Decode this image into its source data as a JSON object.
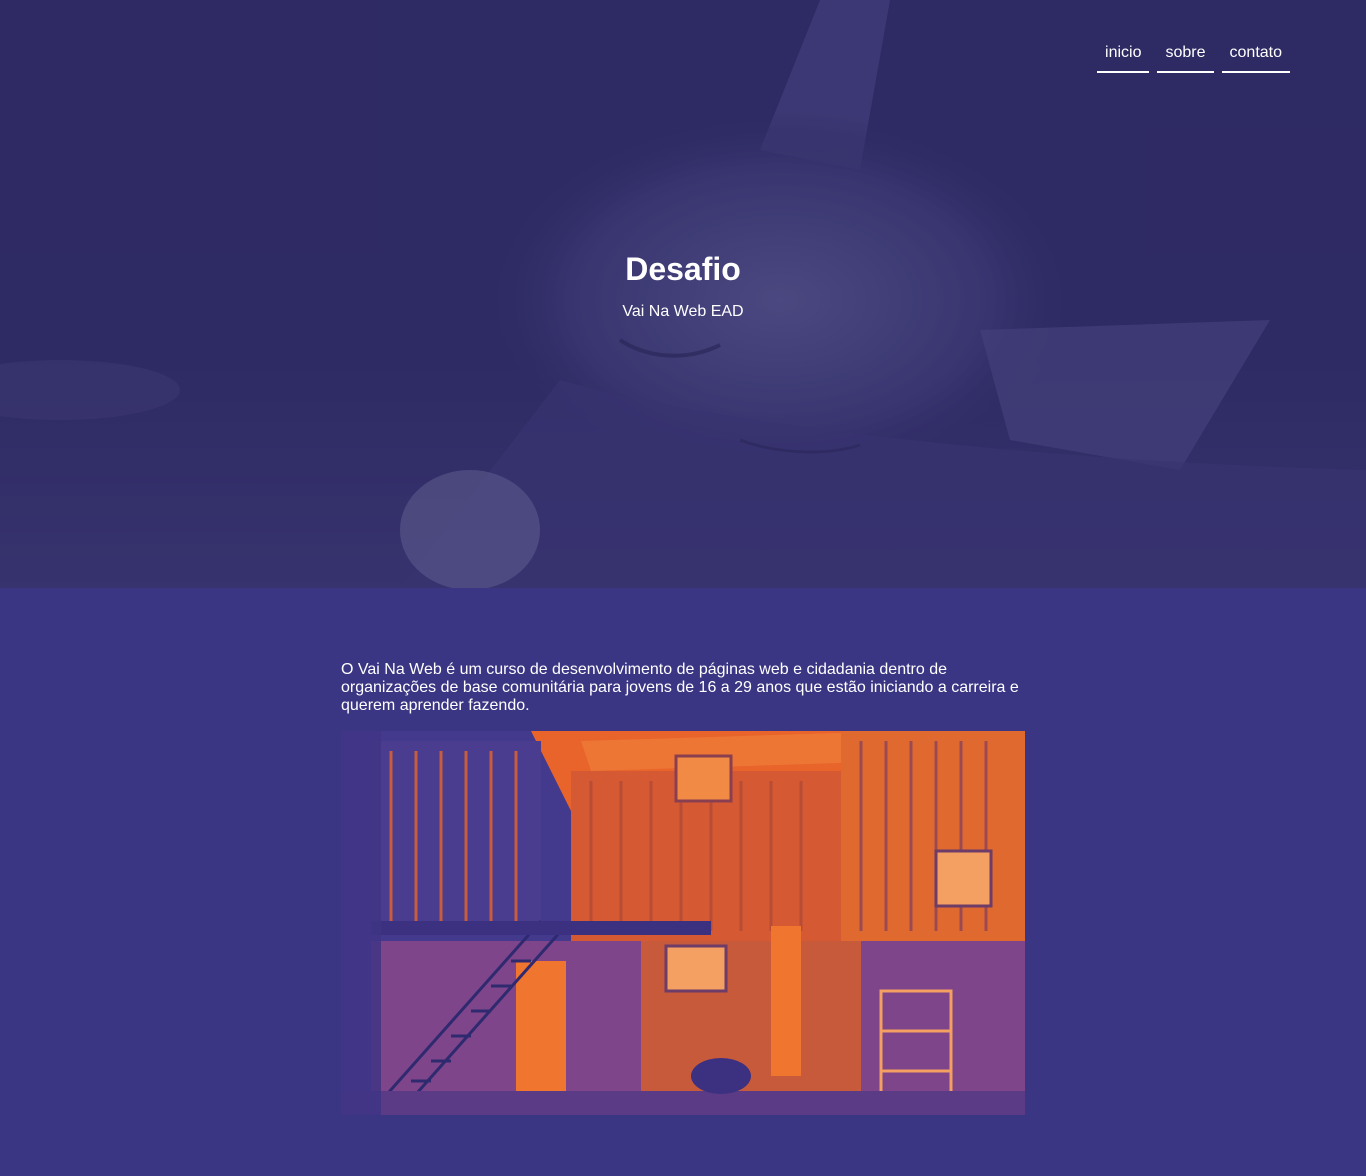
{
  "nav": {
    "items": [
      {
        "label": "inicio"
      },
      {
        "label": "sobre"
      },
      {
        "label": "contato"
      }
    ]
  },
  "hero": {
    "title": "Desafio",
    "subtitle": "Vai Na Web EAD"
  },
  "content": {
    "intro": "O Vai Na Web é um curso de desenvolvimento de páginas web e cidadania dentro de organizações de base comunitária para jovens de 16 a 29 anos que estão iniciando a carreira e querem aprender fazendo."
  },
  "colors": {
    "hero_bg": "#2f2a63",
    "page_bg": "#3b3683",
    "photo_accent": "#f36a2a"
  }
}
